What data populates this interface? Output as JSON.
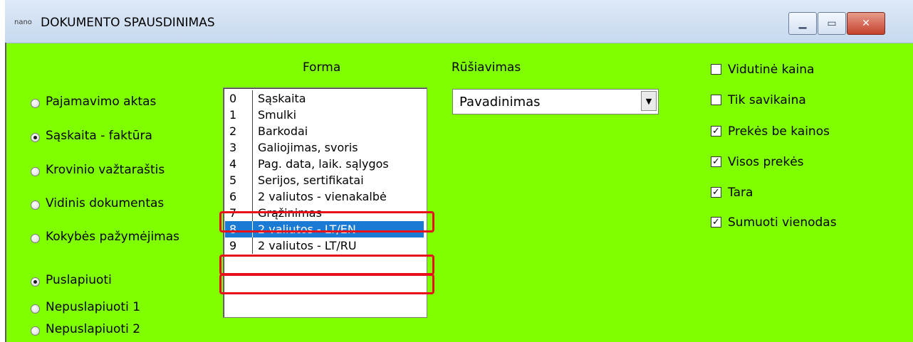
{
  "window": {
    "app_icon": "nano",
    "title": "DOKUMENTO SPAUSDINIMAS",
    "min_icon": "minimize-icon",
    "max_icon": "maximize-icon",
    "close_icon": "close-icon"
  },
  "doc_types": {
    "items": [
      {
        "label": "Pajamavimo aktas",
        "selected": false
      },
      {
        "label": "Sąskaita - faktūra",
        "selected": true
      },
      {
        "label": "Krovinio važtaraštis",
        "selected": false
      },
      {
        "label": "Vidinis dokumentas",
        "selected": false
      },
      {
        "label": "Kokybės pažymėjimas",
        "selected": false
      }
    ]
  },
  "paging": {
    "items": [
      {
        "label": "Puslapiuoti",
        "selected": true
      },
      {
        "label": "Nepuslapiuoti 1",
        "selected": false
      },
      {
        "label": "Nepuslapiuoti 2",
        "selected": false
      }
    ]
  },
  "forma": {
    "heading": "Forma",
    "selected_index": 8,
    "items": [
      {
        "num": "0",
        "label": "Sąskaita"
      },
      {
        "num": "1",
        "label": "Smulki"
      },
      {
        "num": "2",
        "label": "Barkodai"
      },
      {
        "num": "3",
        "label": "Galiojimas, svoris"
      },
      {
        "num": "4",
        "label": "Pag. data, laik. sąlygos"
      },
      {
        "num": "5",
        "label": "Serijos, sertifikatai"
      },
      {
        "num": "6",
        "label": "2 valiutos - vienakalbė"
      },
      {
        "num": "7",
        "label": "Grąžinimas"
      },
      {
        "num": "8",
        "label": "2 valiutos - LT/EN"
      },
      {
        "num": "9",
        "label": "2 valiutos - LT/RU"
      }
    ]
  },
  "sorting": {
    "heading": "Rūšiavimas",
    "value": "Pavadinimas"
  },
  "options": {
    "items": [
      {
        "label": "Vidutinė kaina",
        "checked": false
      },
      {
        "label": "Tik savikaina",
        "checked": false
      },
      {
        "label": "Prekės be kainos",
        "checked": true
      },
      {
        "label": "Visos prekės",
        "checked": true
      },
      {
        "label": "Tara",
        "checked": true
      },
      {
        "label": "Sumuoti vienodas",
        "checked": true
      }
    ]
  },
  "colors": {
    "background": "#80ff00",
    "selection": "#1a7ad4",
    "highlight": "#e8101a"
  }
}
